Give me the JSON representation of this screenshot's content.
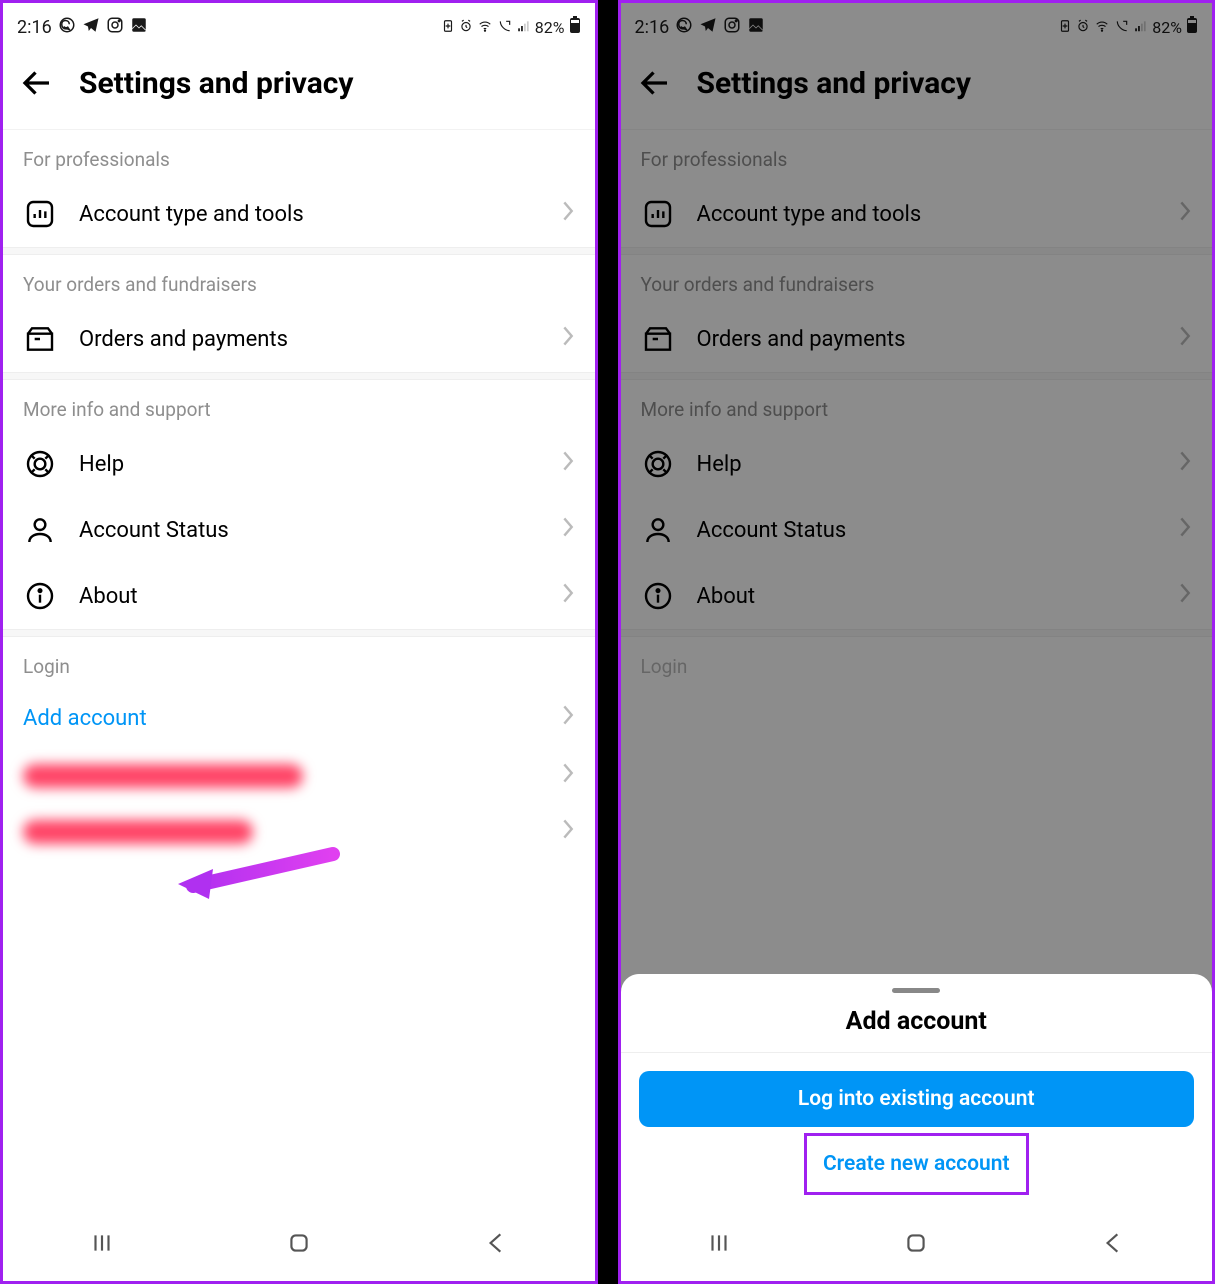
{
  "status": {
    "time": "2:16",
    "battery_text": "82%"
  },
  "header": {
    "title": "Settings and privacy"
  },
  "sections": {
    "professionals": {
      "label": "For professionals",
      "account_tools": "Account type and tools"
    },
    "orders": {
      "label": "Your orders and fundraisers",
      "orders_payments": "Orders and payments"
    },
    "support": {
      "label": "More info and support",
      "help": "Help",
      "account_status": "Account Status",
      "about": "About"
    },
    "login": {
      "label": "Login",
      "add_account": "Add account"
    }
  },
  "sheet": {
    "title": "Add account",
    "login_existing": "Log into existing account",
    "create_new": "Create new account"
  }
}
